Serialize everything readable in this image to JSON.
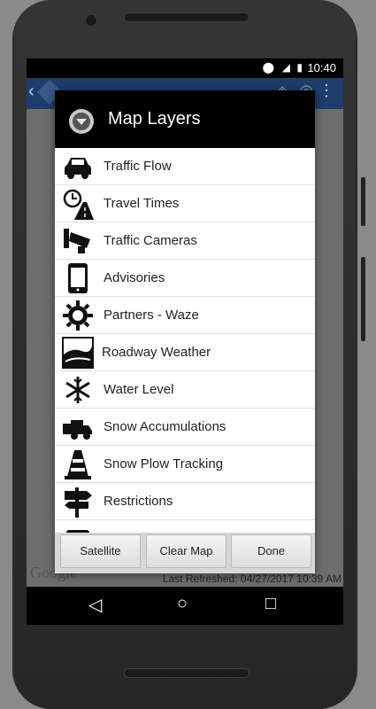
{
  "statusbar": {
    "time": "10:40"
  },
  "dialog": {
    "title": "Map Layers",
    "items": [
      {
        "label": "Traffic Flow",
        "icon": "car-icon"
      },
      {
        "label": "Travel Times",
        "icon": "clock-road-icon"
      },
      {
        "label": "Traffic Cameras",
        "icon": "camera-icon"
      },
      {
        "label": "Advisories",
        "icon": "phone-icon"
      },
      {
        "label": "Partners - Waze",
        "icon": "gear-icon"
      },
      {
        "label": "Roadway Weather",
        "icon": "weather-icon"
      },
      {
        "label": "Water Level",
        "icon": "snowflake-icon"
      },
      {
        "label": "Snow Accumulations",
        "icon": "truck-icon"
      },
      {
        "label": "Snow Plow Tracking",
        "icon": "cone-icon"
      },
      {
        "label": "Restrictions",
        "icon": "signpost-icon"
      }
    ],
    "buttons": {
      "satellite": "Satellite",
      "clear_map": "Clear Map",
      "done": "Done"
    }
  },
  "map": {
    "attribution": "Google",
    "last_refreshed": "Last Refreshed: 04/27/2017 10:39 AM"
  }
}
